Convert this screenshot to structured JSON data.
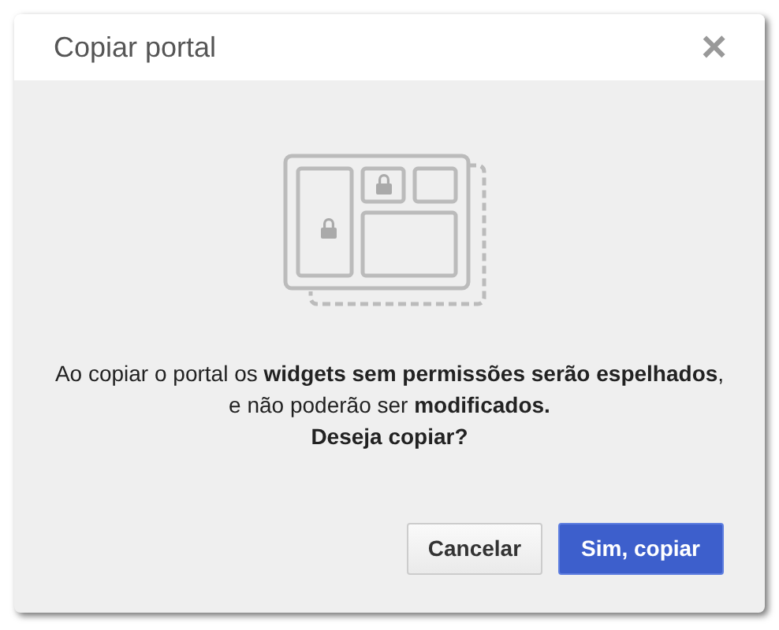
{
  "dialog": {
    "title": "Copiar portal",
    "close": "×",
    "message_lines": [
      "Ao copiar o portal os **widgets sem permissões serão espelhados**,",
      "e não poderão ser **modificados.**",
      "**Deseja copiar?**"
    ],
    "buttons": [
      {
        "label": "Cancelar",
        "kind": "secondary"
      },
      {
        "label": "Sim, copiar",
        "kind": "primary"
      }
    ]
  }
}
